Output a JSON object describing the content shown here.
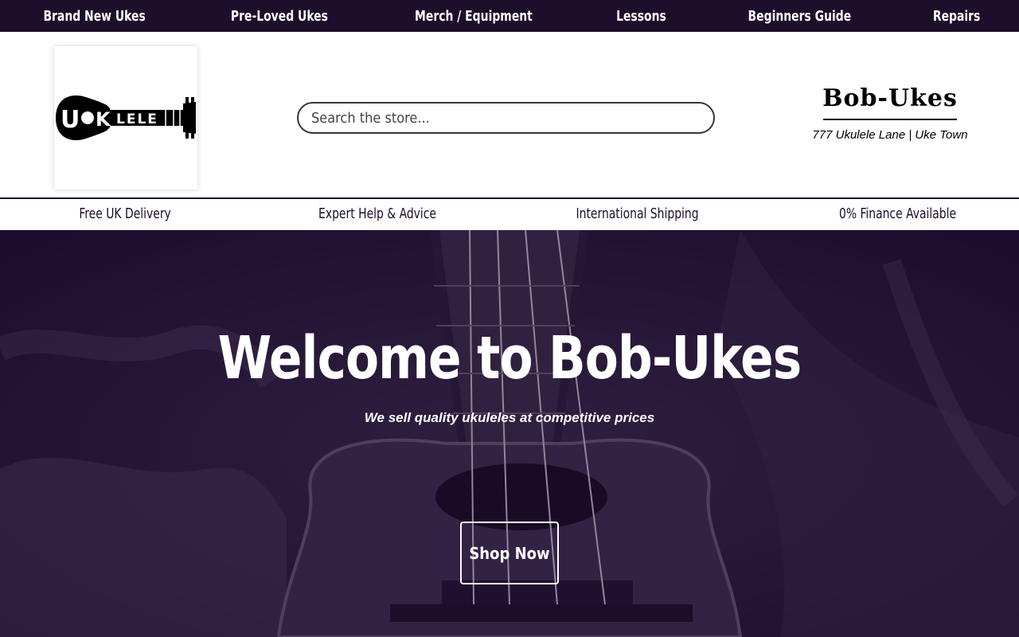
{
  "nav": {
    "items": [
      {
        "label": "Brand New Ukes"
      },
      {
        "label": "Pre-Loved Ukes"
      },
      {
        "label": "Merch / Equipment"
      },
      {
        "label": "Lessons"
      },
      {
        "label": "Beginners Guide"
      },
      {
        "label": "Repairs"
      }
    ]
  },
  "header": {
    "logo_text": "UKULELE",
    "search_placeholder": "Search the store...",
    "brand_name": "Bob-Ukes",
    "address": "777 Ukulele Lane | Uke Town"
  },
  "features": [
    {
      "label": "Free UK Delivery"
    },
    {
      "label": "Expert Help & Advice"
    },
    {
      "label": "International Shipping"
    },
    {
      "label": "0% Finance Available"
    }
  ],
  "hero": {
    "title": "Welcome to Bob-Ukes",
    "subtitle": "We sell quality ukuleles at competitive prices",
    "cta_label": "Shop Now"
  },
  "colors": {
    "brand_dark": "#1d0e2b",
    "hero_overlay": "#2a1a3d",
    "text_light": "#ffffff"
  }
}
